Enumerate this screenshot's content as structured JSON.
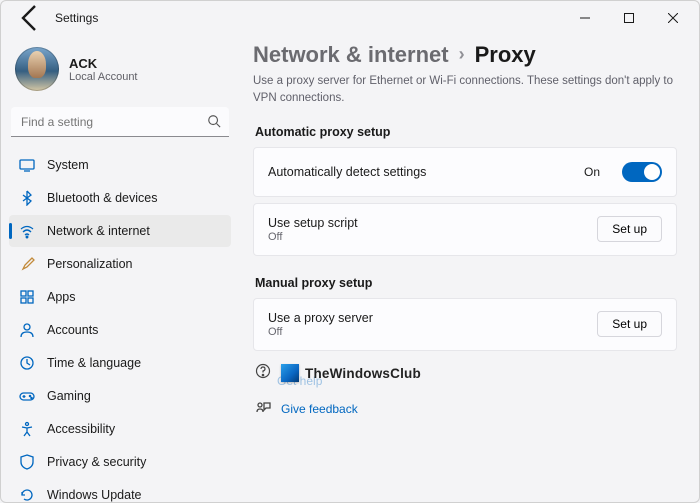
{
  "window": {
    "title": "Settings"
  },
  "profile": {
    "name": "ACK",
    "subtitle": "Local Account"
  },
  "search": {
    "placeholder": "Find a setting"
  },
  "sidebar": {
    "items": [
      {
        "label": "System"
      },
      {
        "label": "Bluetooth & devices"
      },
      {
        "label": "Network & internet"
      },
      {
        "label": "Personalization"
      },
      {
        "label": "Apps"
      },
      {
        "label": "Accounts"
      },
      {
        "label": "Time & language"
      },
      {
        "label": "Gaming"
      },
      {
        "label": "Accessibility"
      },
      {
        "label": "Privacy & security"
      },
      {
        "label": "Windows Update"
      }
    ]
  },
  "breadcrumb": {
    "parent": "Network & internet",
    "current": "Proxy"
  },
  "description": "Use a proxy server for Ethernet or Wi-Fi connections. These settings don't apply to VPN connections.",
  "sections": {
    "auto": {
      "heading": "Automatic proxy setup",
      "detect": {
        "title": "Automatically detect settings",
        "state": "On"
      },
      "script": {
        "title": "Use setup script",
        "state": "Off",
        "button": "Set up"
      }
    },
    "manual": {
      "heading": "Manual proxy setup",
      "proxy": {
        "title": "Use a proxy server",
        "state": "Off",
        "button": "Set up"
      }
    }
  },
  "watermark": {
    "text": "TheWindowsClub"
  },
  "links": {
    "help": "Get help",
    "feedback": "Give feedback"
  },
  "colors": {
    "accent": "#0067c0"
  }
}
